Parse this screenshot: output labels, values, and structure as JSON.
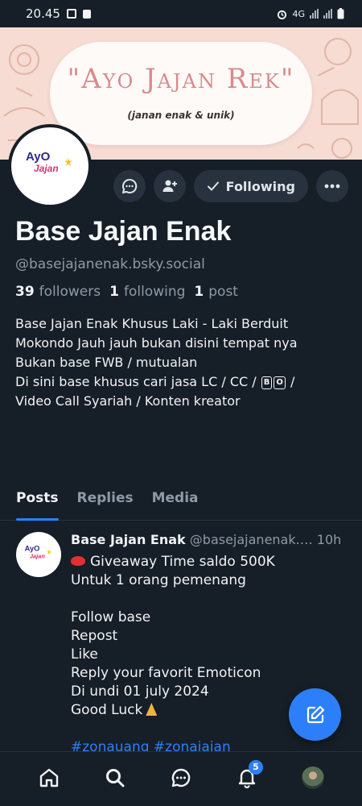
{
  "status_bar": {
    "time": "20.45",
    "network": "4G"
  },
  "banner": {
    "title": "\"Ayo Jajan Rek\"",
    "subtitle": "(janan enak & unik)"
  },
  "avatar_logo": {
    "line1": "AyO",
    "line2": "Jajan"
  },
  "actions": {
    "following_label": "Following"
  },
  "profile": {
    "display_name": "Base Jajan Enak",
    "handle": "@basejajanenak.bsky.social",
    "followers_count": "39",
    "followers_label": "followers",
    "following_count": "1",
    "following_label": "following",
    "posts_count": "1",
    "posts_label": "post",
    "bio": {
      "line1": "Base Jajan Enak Khusus Laki - Laki Berduit",
      "line2": "Mokondo Jauh jauh bukan disini tempat nya",
      "line3": "Bukan base FWB / mutualan",
      "line4_pre": "Di sini base khusus cari jasa LC / CC /",
      "line4_box1": "B",
      "line4_box2": "O",
      "line4_post": "/",
      "line5": "Video Call Syariah / Konten kreator"
    }
  },
  "tabs": [
    {
      "label": "Posts"
    },
    {
      "label": "Replies"
    },
    {
      "label": "Media"
    }
  ],
  "post": {
    "author": "Base Jajan Enak",
    "handle": "@basejajanenak.…",
    "time": "10h",
    "lines": [
      "Giveaway Time saldo 500K",
      "Untuk 1 orang pemenang",
      "",
      "Follow base",
      "Repost",
      "Like",
      "Reply your favorit Emoticon",
      "Di undi 01 july 2024",
      "Good Luck"
    ],
    "hashtags": "#zonauang #zonajajan"
  },
  "bottom_nav": {
    "notification_badge": "5"
  },
  "colors": {
    "background": "#161e27",
    "accent": "#2d7ff9",
    "muted_text": "#8f9aa6",
    "button_bg": "#28323e"
  },
  "icons": {
    "status": [
      "image-icon",
      "lock-icon",
      "alarm-icon",
      "signal-icon",
      "battery-icon"
    ],
    "actions": [
      "chat-icon",
      "add-person-icon",
      "check-icon",
      "more-icon"
    ],
    "nav": [
      "home-icon",
      "search-icon",
      "messages-icon",
      "notifications-icon",
      "profile-avatar"
    ],
    "fab": "compose-icon"
  }
}
